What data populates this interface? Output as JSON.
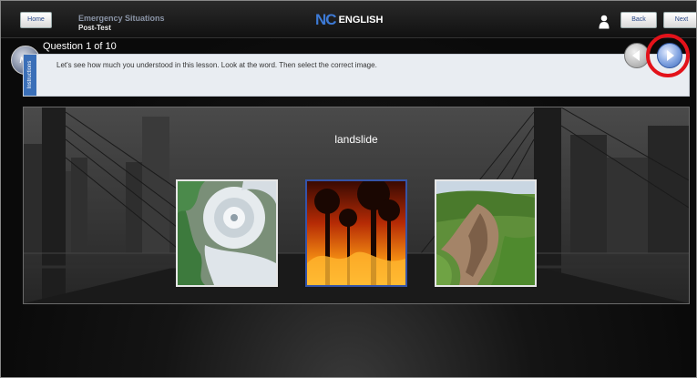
{
  "topbar": {
    "home_label": "Home",
    "lesson_title": "Emergency Situations",
    "lesson_subtitle": "Post-Test",
    "logo_nc": "NC",
    "logo_text": "ENGLISH",
    "back_label": "Back",
    "next_label": "Next"
  },
  "question": {
    "badge": "NC",
    "counter": "Question 1 of 10",
    "instructions_tab": "Instructions",
    "instructions": "Let's see how much you understood in this lesson. Look at the word. Then select the correct image."
  },
  "stage": {
    "word": "landslide",
    "choices": [
      {
        "icon": "hurricane-satellite-image"
      },
      {
        "icon": "forest-fire-image"
      },
      {
        "icon": "landslide-image"
      }
    ]
  },
  "colors": {
    "accent_blue": "#3a6fb8",
    "highlight_red": "#e3121a",
    "selected_border": "#3554a8"
  }
}
